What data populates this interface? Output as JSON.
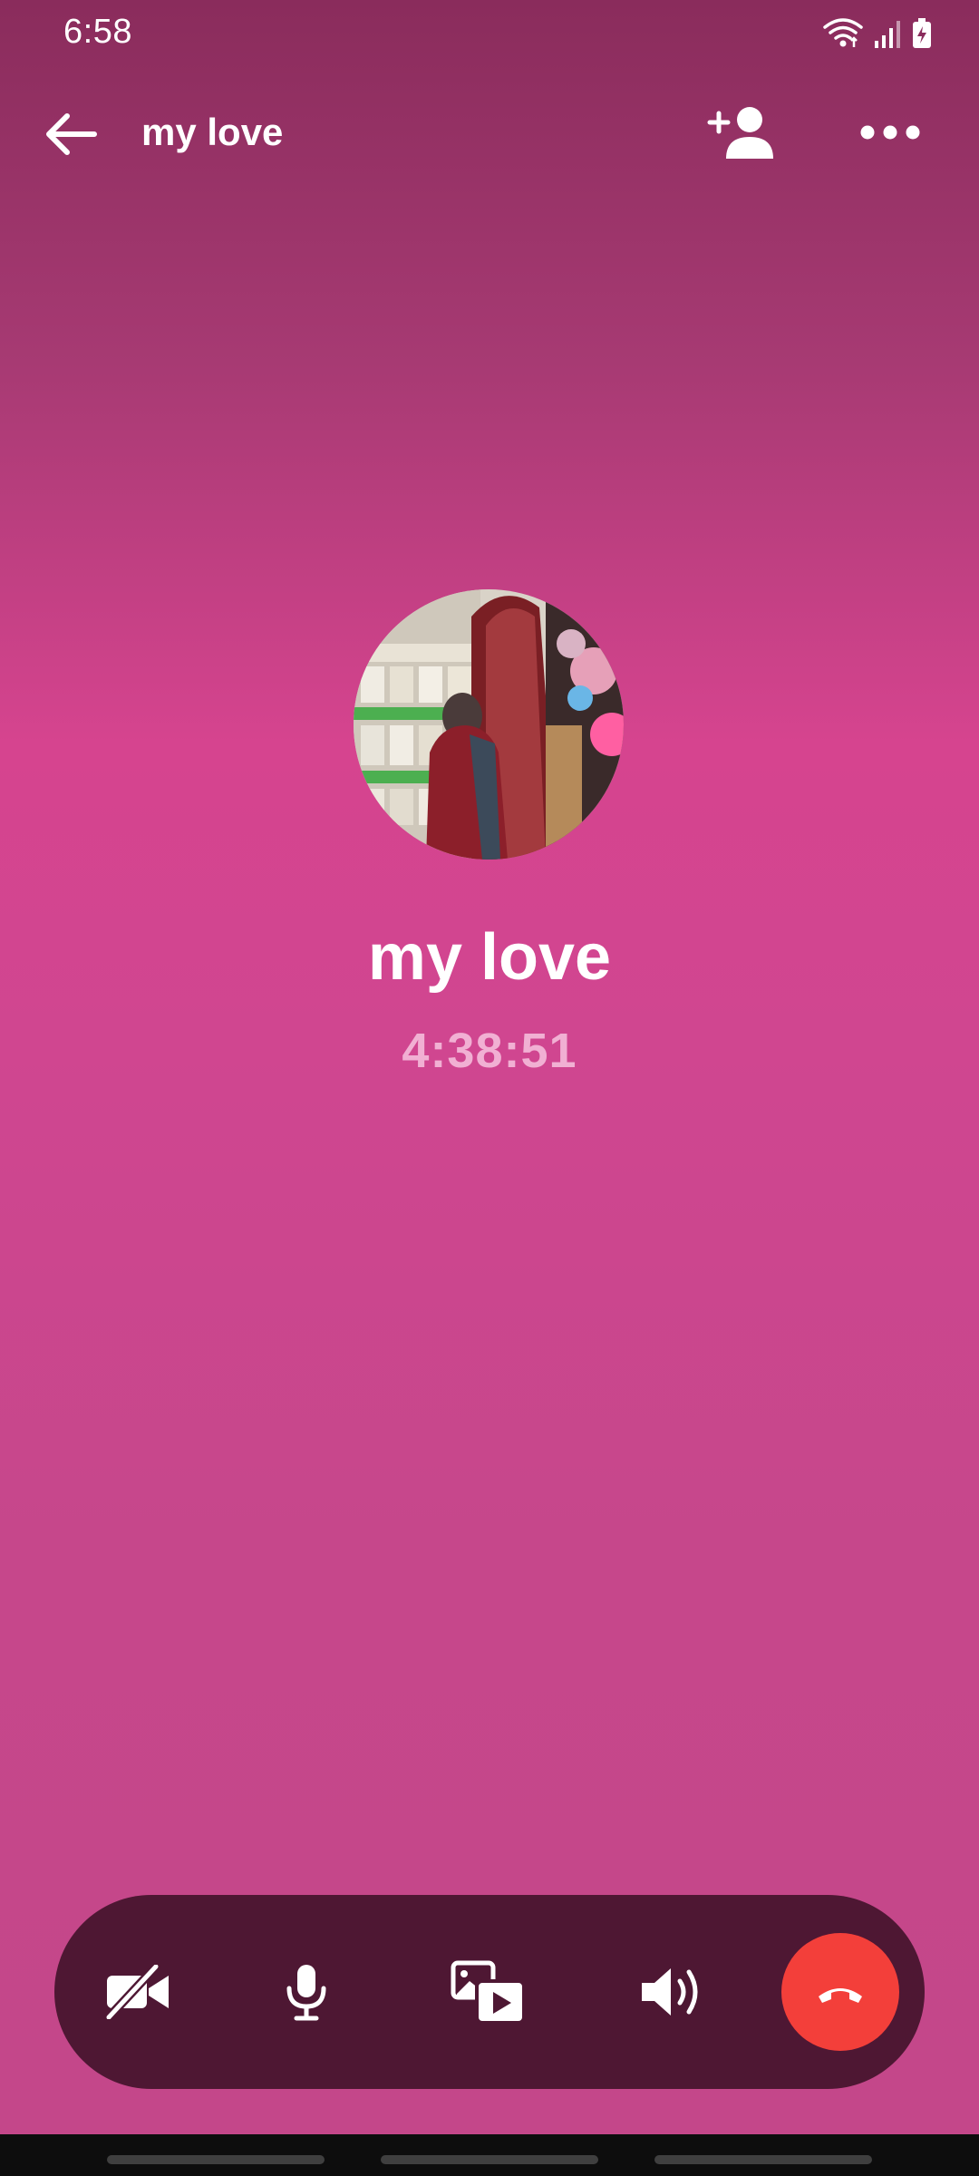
{
  "status_bar": {
    "time": "6:58",
    "icons": [
      "wifi-icon",
      "signal-icon",
      "battery-icon"
    ]
  },
  "app_bar": {
    "title": "my love",
    "back_icon": "arrow-left-icon",
    "add_person_icon": "add-person-icon",
    "more_icon": "more-horizontal-icon"
  },
  "call": {
    "contact_name": "my love",
    "duration": "4:38:51"
  },
  "controls": [
    {
      "name": "video-off",
      "icon": "video-off-icon"
    },
    {
      "name": "microphone",
      "icon": "microphone-icon"
    },
    {
      "name": "share-media",
      "icon": "media-share-icon"
    },
    {
      "name": "speaker",
      "icon": "speaker-icon"
    },
    {
      "name": "end-call",
      "icon": "hang-up-icon"
    }
  ],
  "colors": {
    "background_top": "#8a2c5c",
    "background_mid": "#d6448f",
    "control_bar": "#4e1733",
    "end_call": "#f33f3a",
    "timer_text": "#f1b0d3"
  }
}
